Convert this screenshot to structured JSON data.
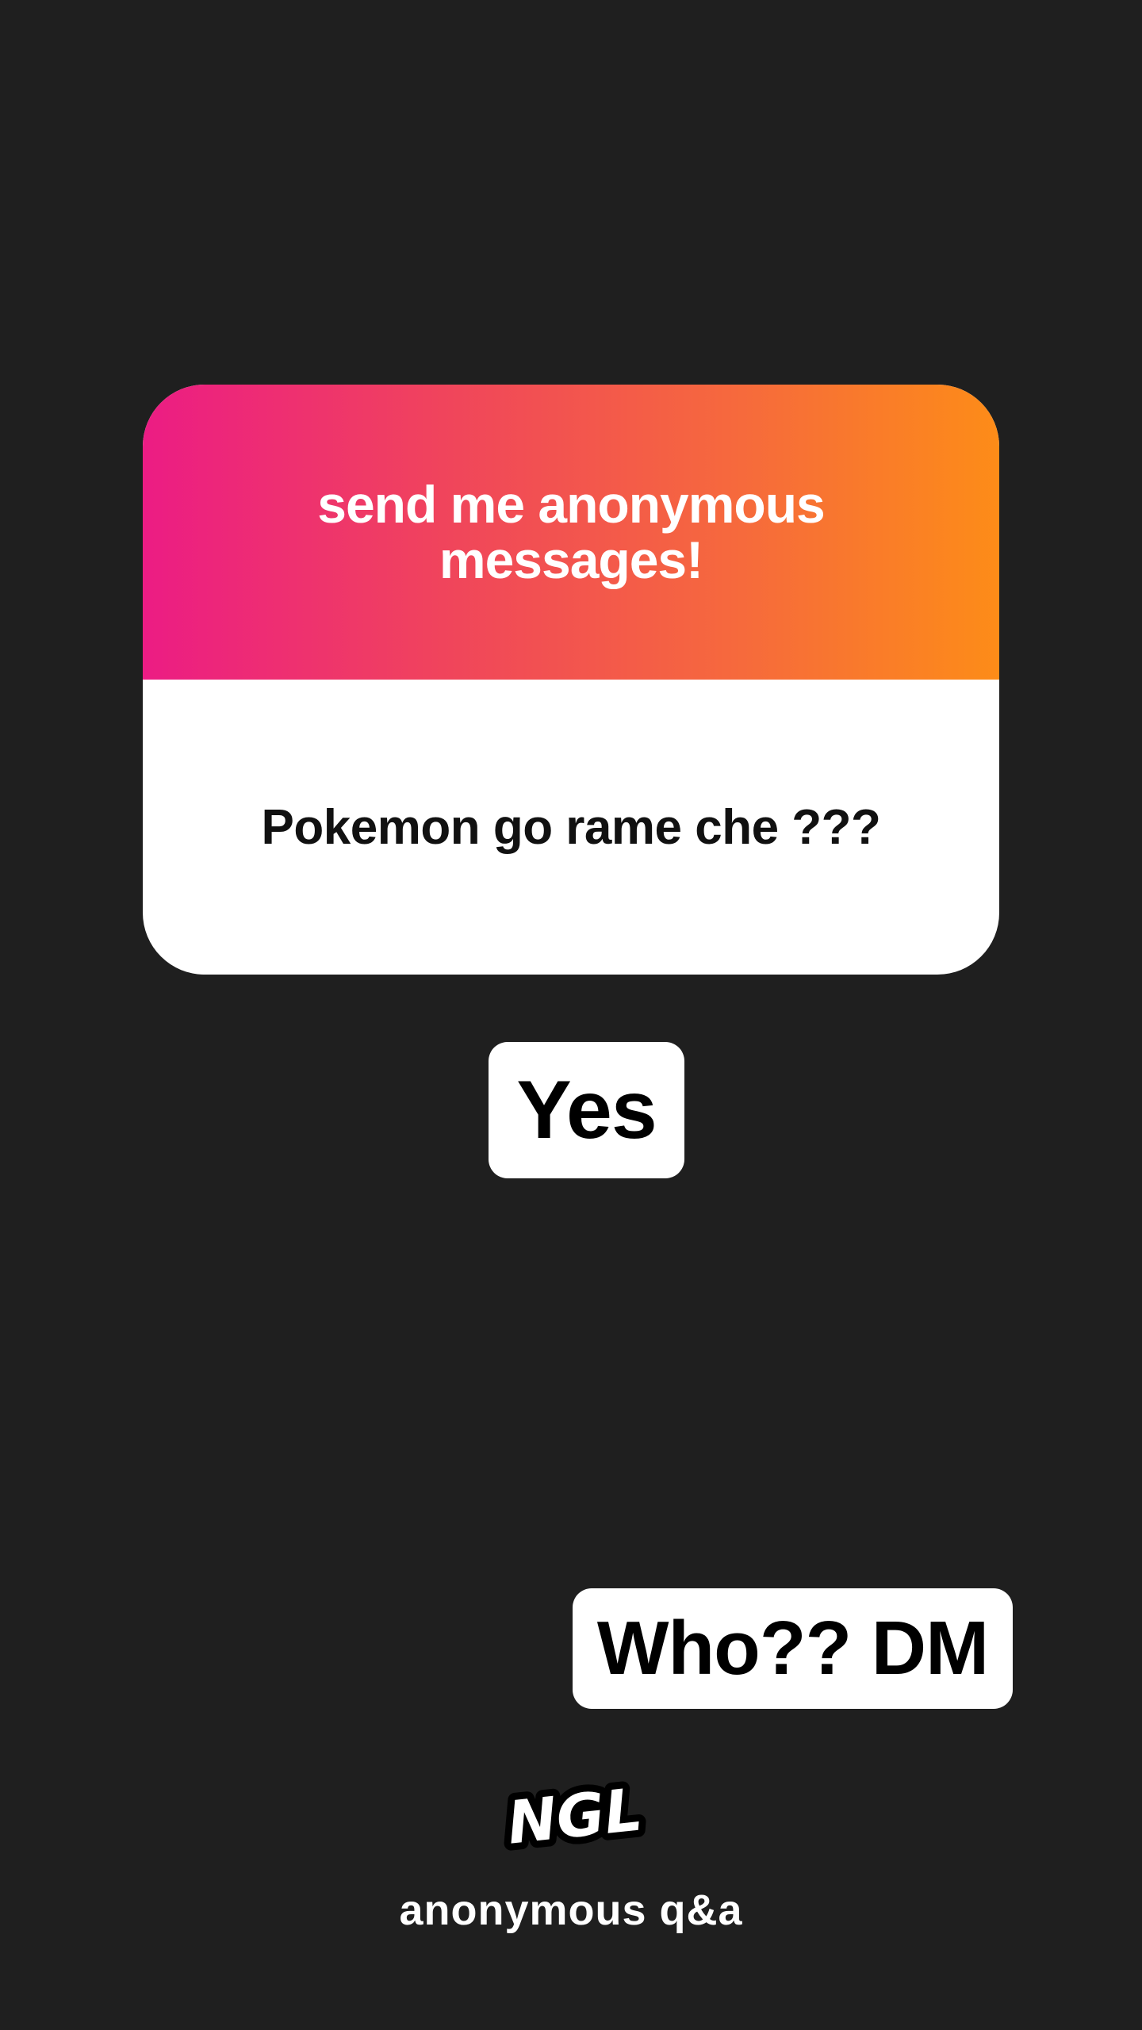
{
  "card": {
    "title": "send me anonymous messages!",
    "question": "Pokemon go rame che ???",
    "gradient_start": "#ec1c84",
    "gradient_end": "#fd8c18"
  },
  "stickers": {
    "yes": "Yes",
    "dm": "Who?? DM"
  },
  "brand": {
    "logo_text": "NGL",
    "caption": "anonymous q&a"
  },
  "colors": {
    "background": "#1f1f1f",
    "card_body": "#ffffff",
    "sticker_bg": "#ffffff"
  }
}
